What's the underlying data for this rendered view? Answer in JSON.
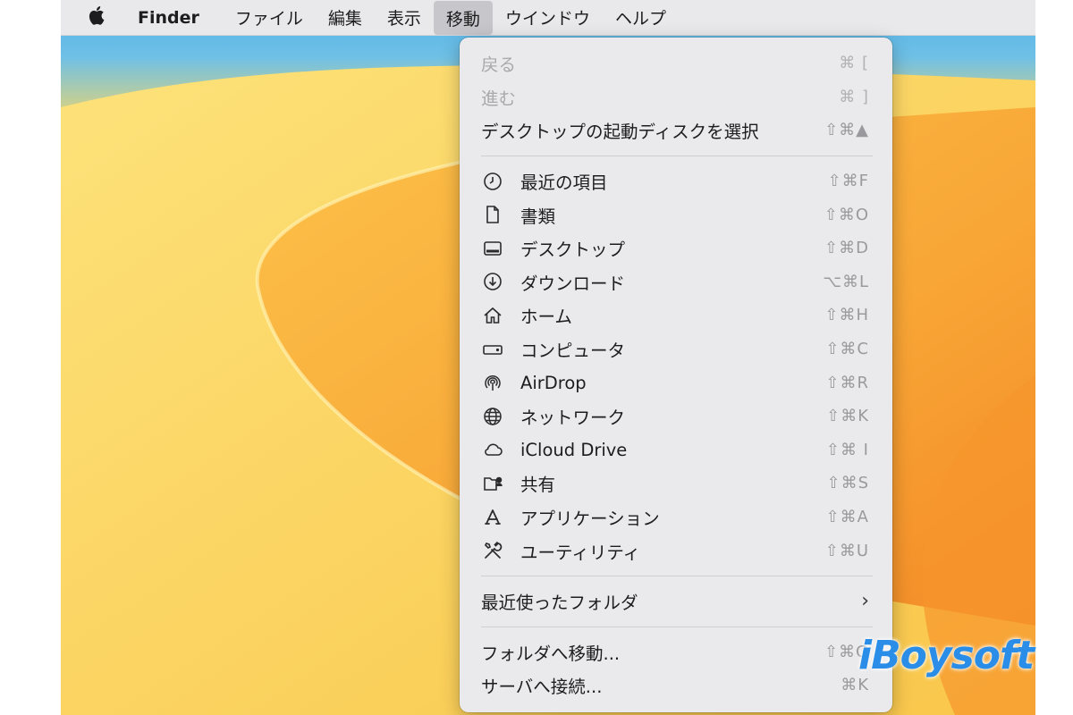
{
  "menubar": {
    "apple_icon": "apple-logo-icon",
    "app_name": "Finder",
    "items": [
      "ファイル",
      "編集",
      "表示",
      "移動",
      "ウインドウ",
      "ヘルプ"
    ],
    "active_menu": "移動"
  },
  "go_menu": {
    "nav": [
      {
        "label": "戻る",
        "shortcut": "⌘ [",
        "enabled": false
      },
      {
        "label": "進む",
        "shortcut": "⌘ ]",
        "enabled": false
      },
      {
        "label": "デスクトップの起動ディスクを選択",
        "shortcut": "⇧⌘▲",
        "enabled": true
      }
    ],
    "locations": [
      {
        "label": "最近の項目",
        "shortcut": "⇧⌘F",
        "icon": "clock-icon"
      },
      {
        "label": "書類",
        "shortcut": "⇧⌘O",
        "icon": "document-icon"
      },
      {
        "label": "デスクトップ",
        "shortcut": "⇧⌘D",
        "icon": "desktop-icon"
      },
      {
        "label": "ダウンロード",
        "shortcut": "⌥⌘L",
        "icon": "download-icon"
      },
      {
        "label": "ホーム",
        "shortcut": "⇧⌘H",
        "icon": "home-icon"
      },
      {
        "label": "コンピュータ",
        "shortcut": "⇧⌘C",
        "icon": "computer-icon"
      },
      {
        "label": "AirDrop",
        "shortcut": "⇧⌘R",
        "icon": "airdrop-icon"
      },
      {
        "label": "ネットワーク",
        "shortcut": "⇧⌘K",
        "icon": "network-icon"
      },
      {
        "label": "iCloud Drive",
        "shortcut": "⇧⌘ I",
        "icon": "cloud-icon"
      },
      {
        "label": "共有",
        "shortcut": "⇧⌘S",
        "icon": "shared-folder-icon"
      },
      {
        "label": "アプリケーション",
        "shortcut": "⇧⌘A",
        "icon": "applications-icon"
      },
      {
        "label": "ユーティリティ",
        "shortcut": "⇧⌘U",
        "icon": "utilities-icon"
      }
    ],
    "recent_folders": {
      "label": "最近使ったフォルダ",
      "indicator": "›"
    },
    "bottom": [
      {
        "label": "フォルダへ移動...",
        "shortcut": "⇧⌘G"
      },
      {
        "label": "サーバへ接続...",
        "shortcut": "⌘K"
      }
    ]
  },
  "watermark": "iBoysoft"
}
